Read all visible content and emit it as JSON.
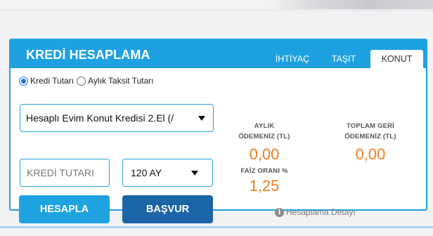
{
  "widget": {
    "title": "KREDİ HESAPLAMA",
    "tabs": [
      {
        "label": "İHTİYAÇ",
        "active": false
      },
      {
        "label": "TAŞIT",
        "active": false
      },
      {
        "label": "KONUT",
        "active": true
      }
    ]
  },
  "form": {
    "radio_options": [
      {
        "label": "Kredi Tutarı",
        "checked": true
      },
      {
        "label": "Aylık Taksit Tutarı",
        "checked": false
      }
    ],
    "product_select": "Hesaplı Evim Konut Kredisi 2.El (/",
    "amount_placeholder": "KREDİ TUTARI",
    "amount_value": "",
    "term_select": "120 AY",
    "calc_button": "HESAPLA",
    "apply_button": "BAŞVUR"
  },
  "results": {
    "monthly_label_1": "AYLIK",
    "monthly_label_2": "ÖDEMENİZ (TL)",
    "monthly_value": "0,00",
    "total_label_1": "TOPLAM GERİ",
    "total_label_2": "ÖDEMENİZ (TL)",
    "total_value": "0,00",
    "rate_label": "FAİZ ORANI %",
    "rate_value": "1,25",
    "detail_link": "Hesaplama Detayı"
  },
  "colors": {
    "accent": "#1ea1e1",
    "apply_button": "#1b64a6",
    "result_value": "#ee7d1f"
  },
  "icons": {
    "info": "info-circle-icon",
    "caret": "caret-down-icon"
  }
}
